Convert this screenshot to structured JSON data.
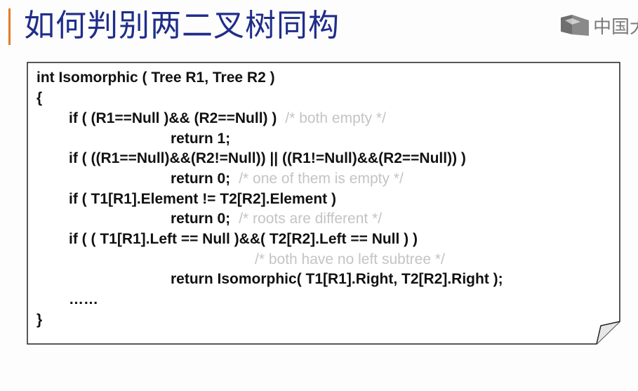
{
  "slide": {
    "title": "如何判别两二叉树同构",
    "watermark_text": "中国大",
    "watermark_icon": "mooc-logo-icon"
  },
  "code": {
    "lines": [
      {
        "code": "int  Isomorphic ( Tree R1, Tree R2 )",
        "comment": ""
      },
      {
        "code": "{",
        "comment": ""
      },
      {
        "code": "if  ( (R1==Null )&& (R2==Null) )",
        "comment": "/* both empty */"
      },
      {
        "code": "return  1;",
        "comment": ""
      },
      {
        "code": "if  ( ((R1==Null)&&(R2!=Null)) || ((R1!=Null)&&(R2==Null)) )",
        "comment": ""
      },
      {
        "code": "return  0;",
        "comment": "/* one of them is empty */"
      },
      {
        "code": "if  ( T1[R1].Element != T2[R2].Element )",
        "comment": ""
      },
      {
        "code": "return  0;",
        "comment": "/* roots are different */"
      },
      {
        "code": "if  ( ( T1[R1].Left == Null )&&( T2[R2].Left == Null ) )",
        "comment": ""
      },
      {
        "code": "",
        "comment": "/* both have no left subtree */"
      },
      {
        "code": "return  Isomorphic( T1[R1].Right, T2[R2].Right );",
        "comment": ""
      },
      {
        "code": "……",
        "comment": ""
      },
      {
        "code": "}",
        "comment": ""
      }
    ]
  },
  "colors": {
    "title": "#1f2d8a",
    "accent": "#e07b28",
    "comment": "#c4c4c4",
    "code": "#111111"
  }
}
